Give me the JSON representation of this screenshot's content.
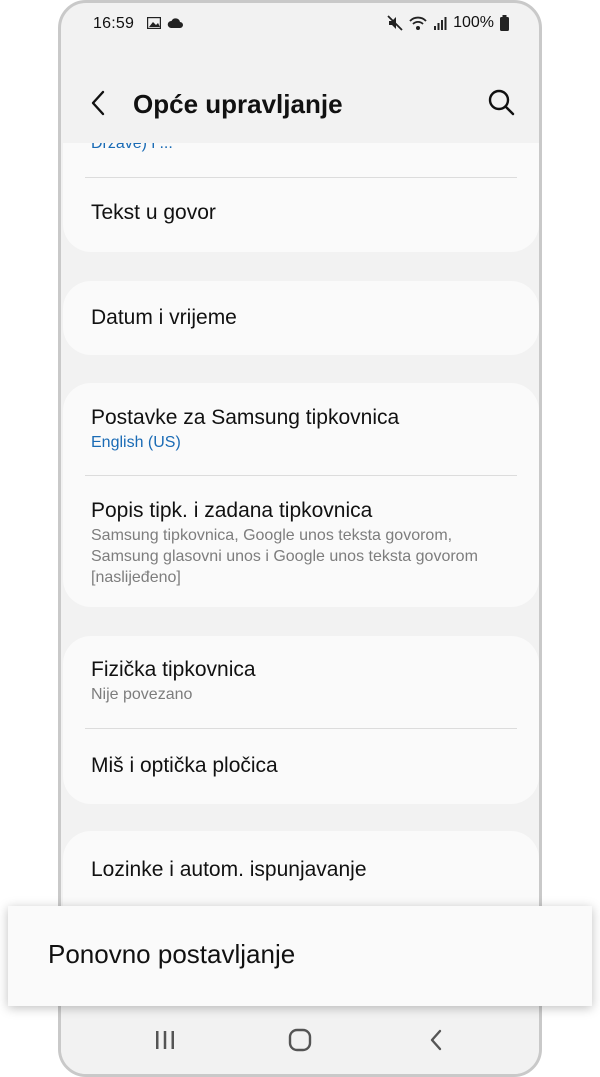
{
  "status_bar": {
    "time": "16:59",
    "battery": "100%",
    "left_icons": [
      "image-icon",
      "cloud-icon"
    ],
    "right_icons": [
      "mute-icon",
      "wifi-icon",
      "signal-icon",
      "battery-icon"
    ]
  },
  "header": {
    "title": "Opće upravljanje",
    "back_icon": "back-arrow-icon",
    "search_icon": "search-icon"
  },
  "sections": [
    {
      "items": [
        {
          "title": "",
          "subtitle": "Države) i ..."
        },
        {
          "title": "Tekst u govor"
        }
      ]
    },
    {
      "items": [
        {
          "title": "Datum i vrijeme"
        }
      ]
    },
    {
      "items": [
        {
          "title": "Postavke za Samsung tipkovnica",
          "subtitle": "English (US)"
        },
        {
          "title": "Popis tipk. i zadana tipkovnica",
          "subtitle": "Samsung tipkovnica, Google unos teksta govorom, Samsung glasovni unos i Google unos teksta govorom [naslijeđeno]"
        }
      ]
    },
    {
      "items": [
        {
          "title": "Fizička tipkovnica",
          "subtitle": "Nije povezano"
        },
        {
          "title": "Miš i optička pločica"
        }
      ]
    },
    {
      "items": [
        {
          "title": "Lozinke i autom. ispunjavanje"
        }
      ]
    }
  ],
  "highlight": {
    "label": "Ponovno postavljanje"
  },
  "navbar": {
    "recents_icon": "recents-icon",
    "home_icon": "home-icon",
    "back_icon": "nav-back-icon"
  },
  "colors": {
    "background": "#f2f2f2",
    "card": "#fafafa",
    "accent_blue": "#1a6bb5",
    "secondary_text": "#7d7d7d"
  }
}
